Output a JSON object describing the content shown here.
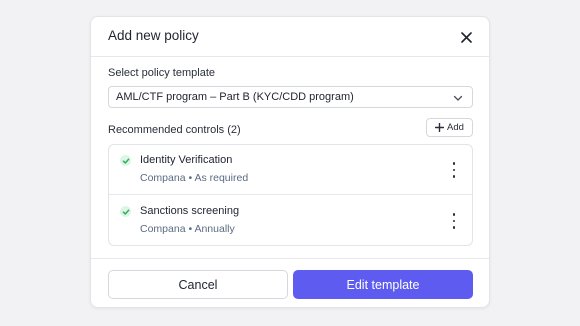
{
  "modal": {
    "title": "Add new policy"
  },
  "template_select": {
    "label": "Select policy template",
    "value": "AML/CTF program – Part B (KYC/CDD program)"
  },
  "controls": {
    "heading": "Recommended controls (2)",
    "add_label": "Add",
    "items": [
      {
        "name": "Identity Verification",
        "meta": "Compana • As required",
        "status": "check-icon"
      },
      {
        "name": "Sanctions screening",
        "meta": "Compana • Annually",
        "status": "check-icon"
      }
    ]
  },
  "footer": {
    "cancel_label": "Cancel",
    "primary_label": "Edit template"
  },
  "colors": {
    "accent": "#5e5cf0",
    "check_green": "#2fae5e",
    "check_bg": "#dcf5e4",
    "meta_text": "#5b6b82"
  }
}
